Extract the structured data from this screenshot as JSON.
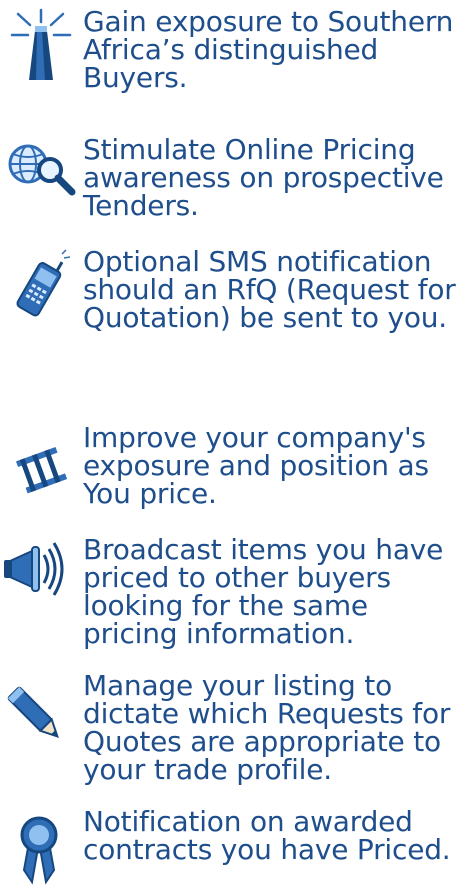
{
  "colors": {
    "text": "#1f4e8c",
    "icon_blue": "#2f6db7",
    "icon_dark": "#16477f",
    "icon_light": "#8fc0ef"
  },
  "features": [
    {
      "icon": "lighthouse-icon",
      "text": "Gain exposure to Southern Africa’s distinguished Buyers."
    },
    {
      "icon": "globe-search-icon",
      "text": "Stimulate Online Pricing awareness on prospective Tenders."
    },
    {
      "icon": "mobile-phone-icon",
      "text": "Optional SMS notification should an RfQ (Request for Quotation) be sent to you."
    },
    {
      "icon": "ladder-icon",
      "text": "Improve your company's exposure and position as You price."
    },
    {
      "icon": "megaphone-icon",
      "text": "Broadcast items you have priced to other buyers looking for the same pricing information."
    },
    {
      "icon": "pencil-icon",
      "text": "Manage your listing to dictate which Requests for Quotes are appropriate to your trade profile."
    },
    {
      "icon": "award-ribbon-icon",
      "text": "Notification on awarded contracts you have Priced."
    }
  ]
}
